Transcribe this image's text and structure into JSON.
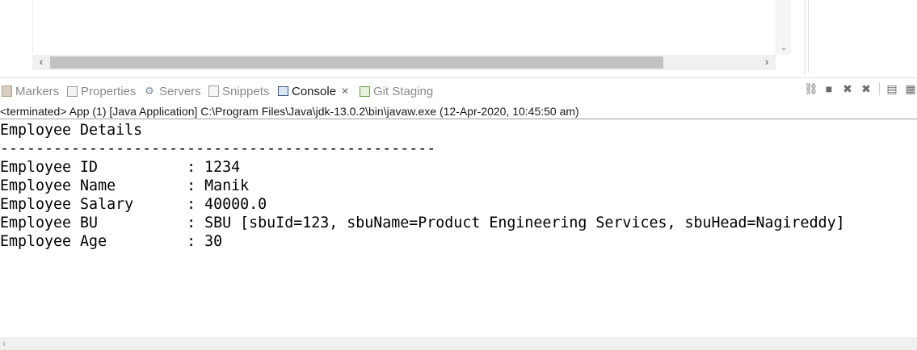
{
  "view_tabs": [
    {
      "label": "Markers",
      "icon": "markers-icon",
      "active": false
    },
    {
      "label": "Properties",
      "icon": "properties-icon",
      "active": false
    },
    {
      "label": "Servers",
      "icon": "servers-icon",
      "active": false
    },
    {
      "label": "Snippets",
      "icon": "snippets-icon",
      "active": false
    },
    {
      "label": "Console",
      "icon": "console-icon",
      "active": true
    },
    {
      "label": "Git Staging",
      "icon": "git-staging-icon",
      "active": false
    }
  ],
  "console": {
    "status": "<terminated> App (1) [Java Application] C:\\Program Files\\Java\\jdk-13.0.2\\bin\\javaw.exe (12-Apr-2020, 10:45:50 am)",
    "lines": [
      "Employee Details",
      "-------------------------------------------------",
      "Employee ID          : 1234",
      "Employee Name        : Manik",
      "Employee Salary      : 40000.0",
      "Employee BU          : SBU [sbuId=123, sbuName=Product Engineering Services, sbuHead=Nagireddy]",
      "Employee Age         : 30"
    ]
  },
  "colors": {
    "background": "#ffffff",
    "inactive_tab_text": "#8a8a8a",
    "active_tab_text": "#1a1a1a",
    "scroll_thumb": "#c2c2c2"
  }
}
